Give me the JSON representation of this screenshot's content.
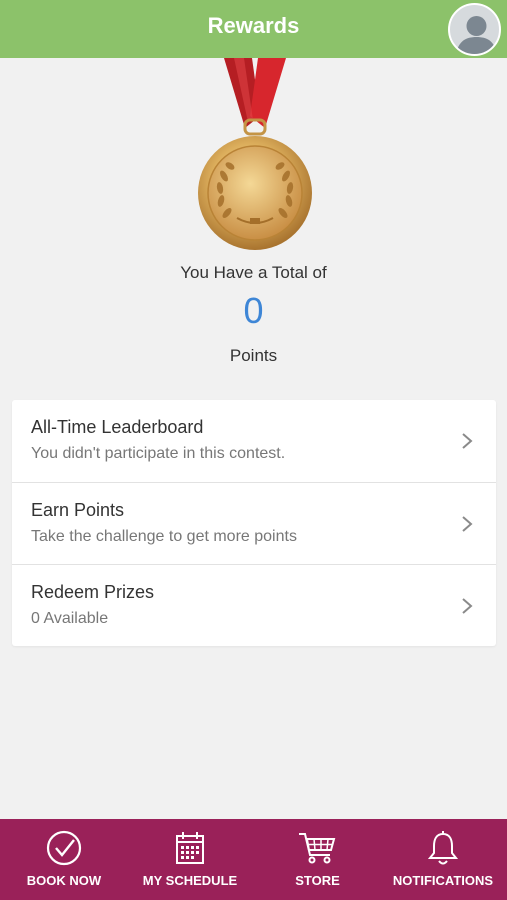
{
  "header": {
    "title": "Rewards",
    "avatar_icon": "user-avatar-icon"
  },
  "rewards": {
    "total_label": "You Have a Total of",
    "points_value": "0",
    "points_label": "Points"
  },
  "menu": {
    "items": [
      {
        "title": "All-Time Leaderboard",
        "subtitle": "You didn't participate in this contest."
      },
      {
        "title": "Earn Points",
        "subtitle": "Take the challenge to get more points"
      },
      {
        "title": "Redeem Prizes",
        "subtitle": "0 Available"
      }
    ]
  },
  "tabbar": {
    "items": [
      {
        "label": "BOOK NOW",
        "icon": "checkmark-circle-icon"
      },
      {
        "label": "MY SCHEDULE",
        "icon": "calendar-icon"
      },
      {
        "label": "STORE",
        "icon": "shopping-cart-icon"
      },
      {
        "label": "NOTIFICATIONS",
        "icon": "bell-icon"
      }
    ]
  },
  "colors": {
    "header_bg": "#8cc26a",
    "tabbar_bg": "#9a2159",
    "points_accent": "#3e86d6",
    "page_bg": "#f1f1f1"
  }
}
